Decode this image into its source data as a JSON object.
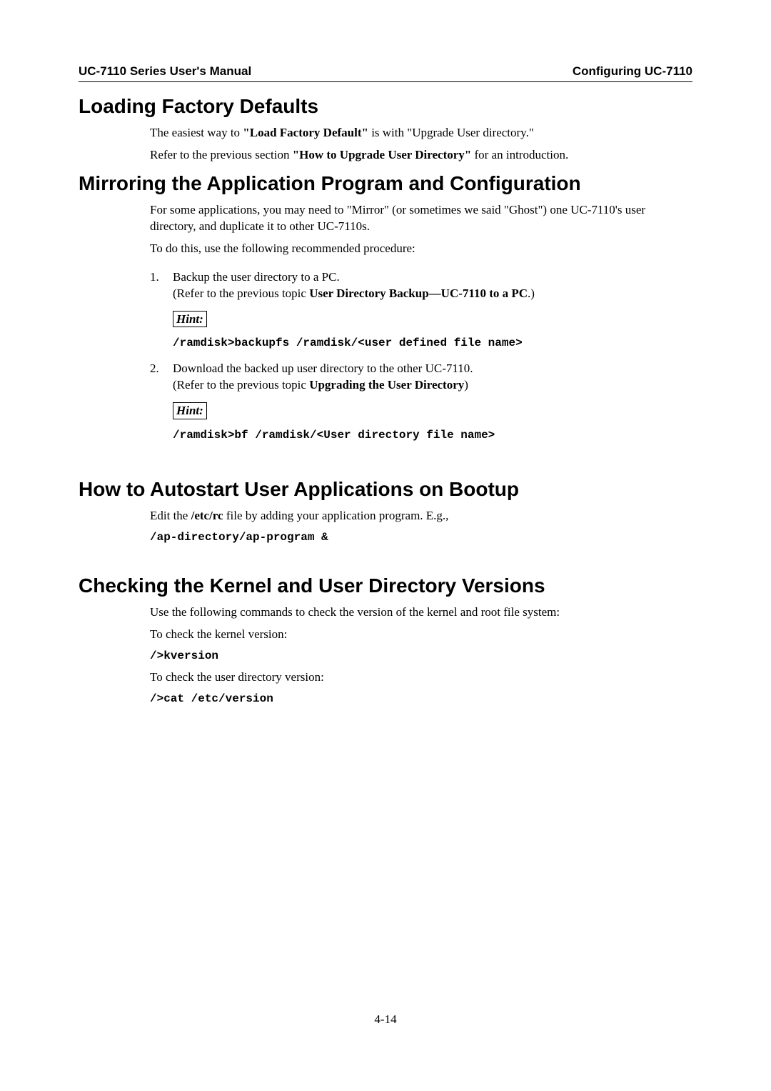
{
  "header": {
    "left": "UC-7110 Series User's Manual",
    "right": "Configuring UC-7110"
  },
  "sections": {
    "loading_defaults": {
      "title": "Loading Factory Defaults",
      "p1_a": "The easiest way to ",
      "p1_b": "\"Load Factory Default\"",
      "p1_c": " is with \"Upgrade User directory.\"",
      "p2_a": "Refer to the previous section ",
      "p2_b": "\"How to Upgrade User Directory\"",
      "p2_c": " for an introduction."
    },
    "mirroring": {
      "title": "Mirroring the Application Program and Configuration",
      "intro": "For some applications, you may need to \"Mirror\" (or sometimes we said \"Ghost\") one UC-7110's user directory, and duplicate it to other UC-7110s.",
      "proc": "To do this, use the following recommended procedure:",
      "step1_line1": "Backup the user directory to a PC.",
      "step1_line2a": "(Refer to the previous topic ",
      "step1_line2b": "User Directory Backup—UC-7110 to a PC",
      "step1_line2c": ".)",
      "hint_label": "Hint:",
      "step1_cmd": "/ramdisk>backupfs /ramdisk/<user defined file name>",
      "step2_line1": "Download the backed up user directory to the other UC-7110.",
      "step2_line2a": "(Refer to the previous topic ",
      "step2_line2b": "Upgrading the User Directory",
      "step2_line2c": ")",
      "step2_cmd": "/ramdisk>bf /ramdisk/<User directory file name>"
    },
    "autostart": {
      "title": "How to Autostart User Applications on Bootup",
      "p1_a": "Edit the ",
      "p1_b": "/etc/rc",
      "p1_c": " file by adding your application program. E.g.,",
      "cmd": "/ap-directory/ap-program &"
    },
    "checking": {
      "title": "Checking the Kernel and User Directory Versions",
      "p1": "Use the following commands to check the version of the kernel and root file system:",
      "p2": "To check the kernel version:",
      "cmd1": "/>kversion",
      "p3": "To check the user directory version:",
      "cmd2": "/>cat /etc/version"
    }
  },
  "page_number": "4-14"
}
